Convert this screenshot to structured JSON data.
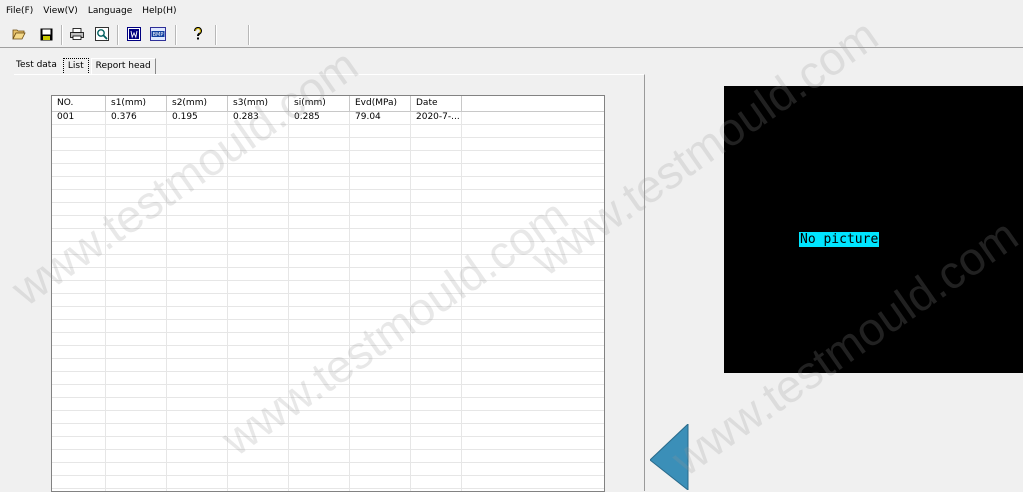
{
  "menu": [
    "File(F)",
    "View(V)",
    "Language",
    "Help(H)"
  ],
  "toolbar": {
    "buttons": [
      "open-icon",
      "save-icon",
      "print-icon",
      "preview-icon",
      "export-word-icon",
      "bmp-icon",
      "help-icon"
    ]
  },
  "tabs": [
    "Test data",
    "List",
    "Report head"
  ],
  "table": {
    "headers": [
      "NO.",
      "s1(mm)",
      "s2(mm)",
      "s3(mm)",
      "si(mm)",
      "Evd(MPa)",
      "Date"
    ],
    "rows": [
      [
        "001",
        "0.376",
        "0.195",
        "0.283",
        "0.285",
        "79.04",
        "2020-7-..."
      ]
    ]
  },
  "picture": {
    "placeholder": "No picture"
  },
  "watermark": "www.testmould.com",
  "colors": {
    "picture_bg": "#000000",
    "placeholder_bg": "#00e5ff",
    "arrow": "#3b8fb8"
  }
}
